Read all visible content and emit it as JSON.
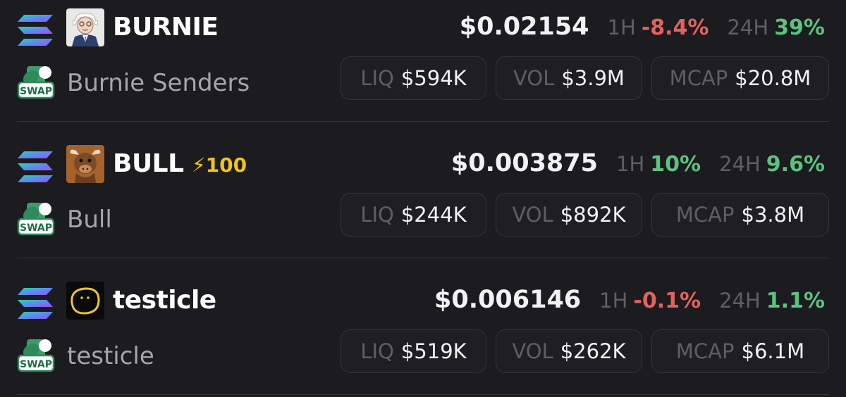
{
  "tokens": [
    {
      "symbol": "BURNIE",
      "name": "Burnie Senders",
      "chain_icon": "solana-icon",
      "swap_icon": "swap-icon",
      "swap_label": "SWAP",
      "avatar": "burnie-avatar",
      "boost": "",
      "price": "$0.02154",
      "h1_label": "1H",
      "h1_change": "-8.4%",
      "h24_label": "24H",
      "h24_change": "39%",
      "liq_label": "LIQ",
      "liq": "$594K",
      "vol_label": "VOL",
      "vol": "$3.9M",
      "mcap_label": "MCAP",
      "mcap": "$20.8M"
    },
    {
      "symbol": "BULL",
      "name": "Bull",
      "chain_icon": "solana-icon",
      "swap_icon": "swap-icon",
      "swap_label": "SWAP",
      "avatar": "bull-avatar",
      "boost": "100",
      "boost_icon": "lightning-icon",
      "price": "$0.003875",
      "h1_label": "1H",
      "h1_change": "10%",
      "h24_label": "24H",
      "h24_change": "9.6%",
      "liq_label": "LIQ",
      "liq": "$244K",
      "vol_label": "VOL",
      "vol": "$892K",
      "mcap_label": "MCAP",
      "mcap": "$3.8M"
    },
    {
      "symbol": "testicle",
      "name": "testicle",
      "chain_icon": "solana-icon",
      "swap_icon": "swap-icon",
      "swap_label": "SWAP",
      "avatar": "testicle-avatar",
      "boost": "",
      "price": "$0.006146",
      "h1_label": "1H",
      "h1_change": "-0.1%",
      "h24_label": "24H",
      "h24_change": "1.1%",
      "liq_label": "LIQ",
      "liq": "$519K",
      "vol_label": "VOL",
      "vol": "$262K",
      "mcap_label": "MCAP",
      "mcap": "$6.1M"
    }
  ],
  "colors": {
    "background": "#1c1b20",
    "positive": "#5cc27f",
    "negative": "#e2635e",
    "boost": "#f0c419",
    "muted": "#5f5e65"
  }
}
